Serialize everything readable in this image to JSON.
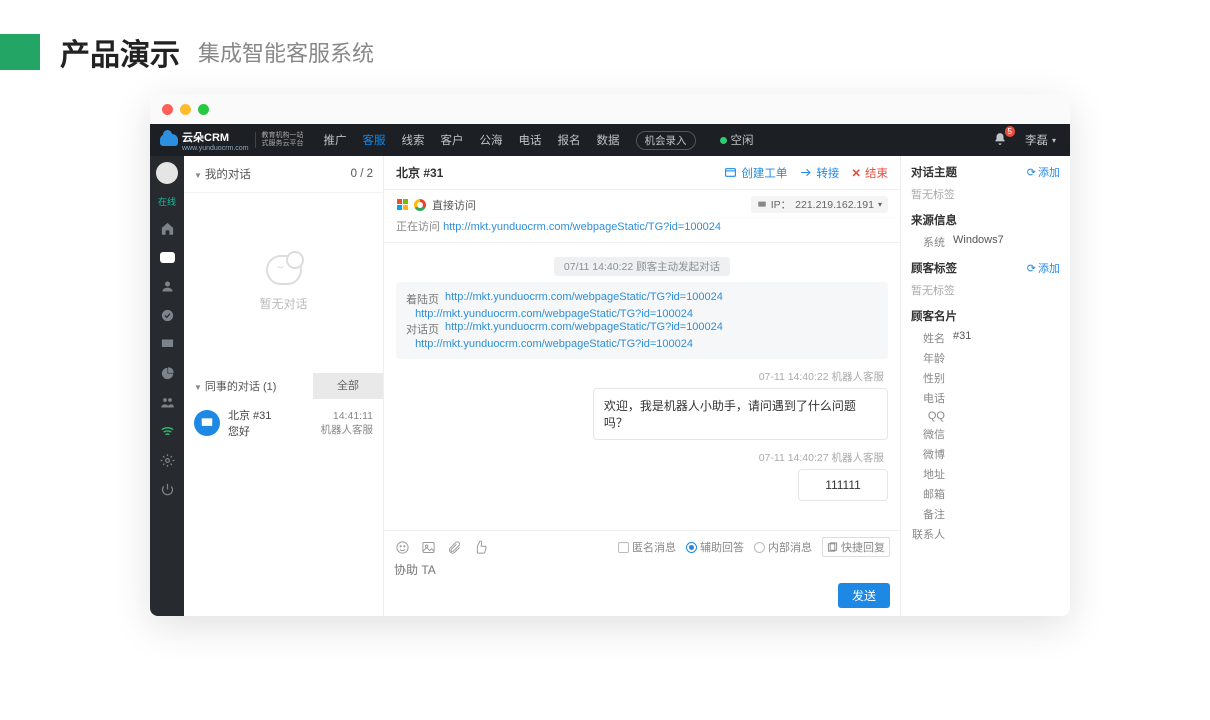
{
  "slide": {
    "title": "产品演示",
    "subtitle": "集成智能客服系统"
  },
  "brand": {
    "name": "云朵CRM",
    "url": "www.yunduocrm.com",
    "tag1": "教育机构一站",
    "tag2": "式服务云平台"
  },
  "nav": {
    "items": [
      "推广",
      "客服",
      "线索",
      "客户",
      "公海",
      "电话",
      "报名",
      "数据"
    ],
    "active_index": 1,
    "record_btn": "机会录入",
    "status_label": "空闲",
    "bell_badge": "5",
    "user": "李磊"
  },
  "rail": {
    "status": "在线"
  },
  "col1": {
    "my_conv": "我的对话",
    "count": "0 / 2",
    "empty": "暂无对话",
    "peer_conv": "同事的对话  (1)",
    "all": "全部",
    "item": {
      "title": "北京 #31",
      "preview": "您好",
      "time": "14:41:11",
      "agent": "机器人客服"
    }
  },
  "col2": {
    "title": "北京 #31",
    "actions": {
      "ticket": "创建工单",
      "transfer": "转接",
      "end": "结束"
    },
    "direct": "直接访问",
    "ip_label": "IP：",
    "ip": "221.219.162.191",
    "visiting_label": "正在访问",
    "visiting_url": "http://mkt.yunduocrm.com/webpageStatic/TG?id=100024",
    "sys_pill": "07/11 14:40:22   顾客主动发起对话",
    "links": {
      "landing": "着陆页",
      "dialog": "对话页",
      "urls": [
        "http://mkt.yunduocrm.com/webpageStatic/TG?id=100024",
        "http://mkt.yunduocrm.com/webpageStatic/TG?id=100024",
        "http://mkt.yunduocrm.com/webpageStatic/TG?id=100024",
        "http://mkt.yunduocrm.com/webpageStatic/TG?id=100024"
      ]
    },
    "meta1": "07-11 14:40:22   机器人客服",
    "bubble1": "欢迎，我是机器人小助手，请问遇到了什么问题吗？",
    "meta2": "07-11 14:40:27   机器人客服",
    "bubble2": "111111",
    "composer": {
      "opts": {
        "anon": "匿名消息",
        "assist": "辅助回答",
        "internal": "内部消息",
        "quick": "快捷回复"
      },
      "placeholder": "协助 TA",
      "send": "发送"
    }
  },
  "col3": {
    "topic": "对话主题",
    "add": "添加",
    "none": "暂无标签",
    "source": "来源信息",
    "sys_k": "系统",
    "sys_v": "Windows7",
    "tags": "顾客标签",
    "card": "顾客名片",
    "fields": {
      "name": "姓名",
      "name_v": "#31",
      "age": "年龄",
      "gender": "性别",
      "phone": "电话",
      "qq": "QQ",
      "wechat": "微信",
      "weibo": "微博",
      "address": "地址",
      "email": "邮箱",
      "remark": "备注",
      "contact": "联系人"
    }
  }
}
